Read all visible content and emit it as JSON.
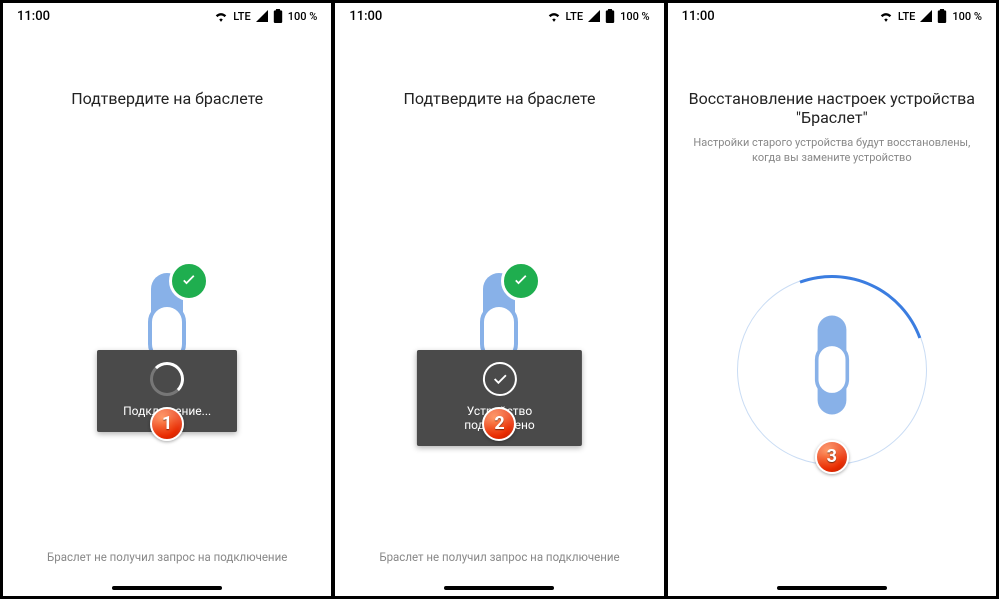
{
  "status": {
    "time": "11:00",
    "lte": "LTE",
    "battery": "100 %"
  },
  "screens": [
    {
      "title": "Подтвердите на браслете",
      "toast": "Подключение...",
      "bottom": "Браслет не получил запрос на подключение",
      "callout": "1"
    },
    {
      "title": "Подтвердите на браслете",
      "toast": "Устройство подключено",
      "bottom": "Браслет не получил запрос на подключение",
      "callout": "2"
    },
    {
      "title": "Восстановление настроек устройства \"Браслет\"",
      "subtitle": "Настройки старого устройства будут восстановлены, когда вы замените устройство",
      "callout": "3"
    }
  ]
}
